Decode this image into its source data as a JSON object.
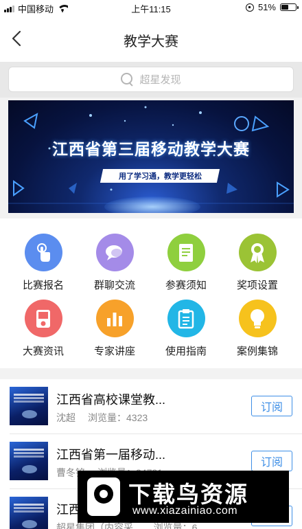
{
  "status_bar": {
    "carrier": "中国移动",
    "time": "上午11:15",
    "battery_percent": "51%",
    "battery_level": 0.51
  },
  "nav": {
    "title": "教学大赛",
    "back_icon": "chevron-left-icon"
  },
  "search": {
    "placeholder": "超星发现",
    "icon": "search-icon"
  },
  "banner": {
    "title": "江西省第三届移动教学大赛",
    "subtitle": "用了学习通，教学更轻松"
  },
  "grid": {
    "items": [
      {
        "label": "比赛报名",
        "icon": "tap-hand-icon",
        "color": "#5b8def"
      },
      {
        "label": "群聊交流",
        "icon": "chat-bubble-icon",
        "color": "#a48be8"
      },
      {
        "label": "参赛须知",
        "icon": "document-icon",
        "color": "#8fcf3e"
      },
      {
        "label": "奖项设置",
        "icon": "award-ribbon-icon",
        "color": "#9bc335"
      },
      {
        "label": "大赛资讯",
        "icon": "media-player-icon",
        "color": "#f06868"
      },
      {
        "label": "专家讲座",
        "icon": "bar-chart-icon",
        "color": "#f7a12a"
      },
      {
        "label": "使用指南",
        "icon": "clipboard-list-icon",
        "color": "#22b6e6"
      },
      {
        "label": "案例集锦",
        "icon": "lightbulb-icon",
        "color": "#f6c21d"
      }
    ]
  },
  "list": {
    "subscribe_label": "订阅",
    "items": [
      {
        "title": "江西省高校课堂教...",
        "author": "沈超",
        "views_label": "浏览量：",
        "views": "4323"
      },
      {
        "title": "江西省第一届移动...",
        "author": "曹冬铭",
        "views_label": "浏览量：",
        "views": "24781"
      },
      {
        "title": "江西...",
        "author": "超星集团（内容采...",
        "views_label": "浏览量：",
        "views": "6..."
      }
    ]
  },
  "watermark": {
    "title": "下载鸟资源",
    "url": "www.xiazainiao.com"
  }
}
